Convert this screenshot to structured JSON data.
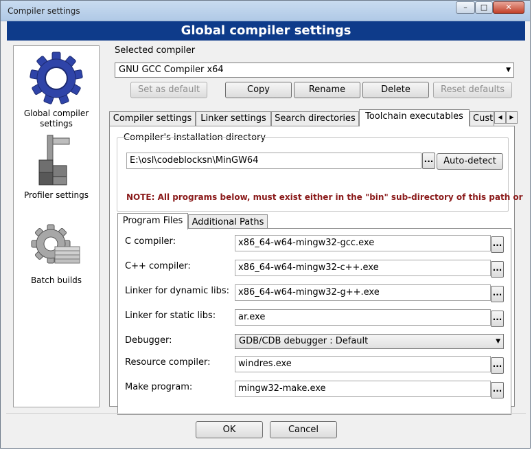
{
  "window": {
    "title": "Compiler settings"
  },
  "banner": "Global compiler settings",
  "sidebar": {
    "items": [
      {
        "label": "Global compiler settings",
        "icon": "gear-icon"
      },
      {
        "label": "Profiler settings",
        "icon": "profiler-icon"
      },
      {
        "label": "Batch builds",
        "icon": "batch-builds-icon"
      }
    ]
  },
  "compiler_select": {
    "label": "Selected compiler",
    "value": "GNU GCC Compiler x64"
  },
  "actions": {
    "set_default": "Set as default",
    "copy": "Copy",
    "rename": "Rename",
    "delete": "Delete",
    "reset_defaults": "Reset defaults"
  },
  "tabs": [
    "Compiler settings",
    "Linker settings",
    "Search directories",
    "Toolchain executables",
    "Cust"
  ],
  "install_dir": {
    "group_label": "Compiler's installation directory",
    "value": "E:\\osl\\codeblocksn\\MinGW64",
    "browse": "...",
    "auto_detect": "Auto-detect",
    "note": "NOTE: All programs below, must exist either in the \"bin\" sub-directory of this path or"
  },
  "subtabs": [
    "Program Files",
    "Additional Paths"
  ],
  "programs": {
    "c_compiler": {
      "label": "C compiler:",
      "value": "x86_64-w64-mingw32-gcc.exe"
    },
    "cpp_compiler": {
      "label": "C++ compiler:",
      "value": "x86_64-w64-mingw32-c++.exe"
    },
    "linker_dynamic": {
      "label": "Linker for dynamic libs:",
      "value": "x86_64-w64-mingw32-g++.exe"
    },
    "linker_static": {
      "label": "Linker for static libs:",
      "value": "ar.exe"
    },
    "debugger": {
      "label": "Debugger:",
      "value": "GDB/CDB debugger : Default"
    },
    "resource_compiler": {
      "label": "Resource compiler:",
      "value": "windres.exe"
    },
    "make_program": {
      "label": "Make program:",
      "value": "mingw32-make.exe"
    },
    "browse": "..."
  },
  "footer": {
    "ok": "OK",
    "cancel": "Cancel"
  },
  "colors": {
    "banner": "#0e3b8a",
    "note": "#8a1a1a",
    "gear": "#2f44a8"
  }
}
